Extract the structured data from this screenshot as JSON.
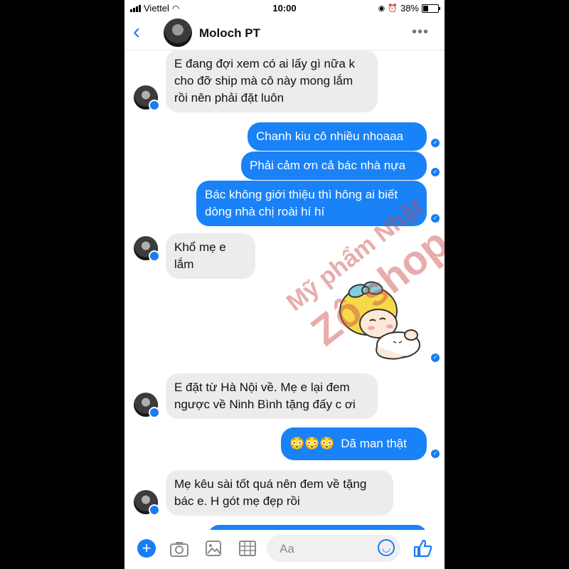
{
  "status_bar": {
    "carrier": "Viettel",
    "time": "10:00",
    "battery": "38%",
    "battery_level": 0.38
  },
  "header": {
    "contact_name": "Moloch PT",
    "back_icon": "chevron-left-icon",
    "more_icon": "more-dots-icon"
  },
  "messages": [
    {
      "sender": "them",
      "lines": [
        "E đang đợi xem có ai lấy gì nữa k",
        "cho đỡ ship mà cô này mong lắm",
        "rồi nên phải đặt luôn"
      ]
    },
    {
      "sender": "me",
      "lines": [
        "Chanh kiu cô nhiều nhoaaa"
      ]
    },
    {
      "sender": "me",
      "lines": [
        "Phải cảm ơn cả bác nhà nựa"
      ]
    },
    {
      "sender": "me",
      "lines": [
        "Bác không giới thiệu thì hông ai biết",
        "dòng nhà chị roài hí hí"
      ]
    },
    {
      "sender": "them",
      "lines": [
        "Khổ mẹ e lắm"
      ]
    },
    {
      "sender": "me",
      "type": "sticker",
      "sticker": "girl-hugging-pillow-sticker"
    },
    {
      "sender": "them",
      "lines": [
        "E đặt từ Hà Nội về. Mẹ e lại đem",
        "ngược về Ninh Bình tặng đấy c ơi"
      ]
    },
    {
      "sender": "me",
      "emojis": "😳😳😳",
      "lines": [
        "Dã man thật"
      ]
    },
    {
      "sender": "them",
      "lines": [
        "Mẹ kêu sài tốt quá nên đem về tặng",
        "bác e. H gót mẹ đẹp rồi"
      ]
    }
  ],
  "watermark": {
    "line1": "Mỹ phẩm Nhật",
    "line2": "Zô shop"
  },
  "composer": {
    "placeholder": "Aa"
  },
  "colors": {
    "accent": "#1a7cf5",
    "outgoing_bubble": "#1a82f7",
    "incoming_bubble": "#ececec",
    "watermark": "#cd4646"
  }
}
